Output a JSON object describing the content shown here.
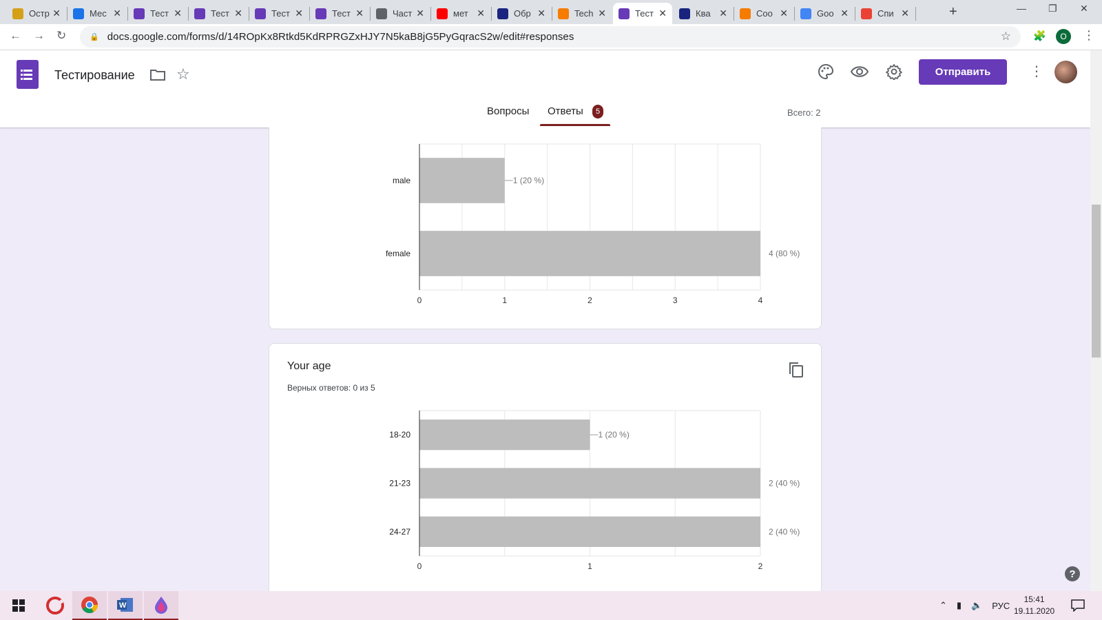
{
  "browser": {
    "tabs": [
      {
        "title": "Остр",
        "favicon_color": "#d4a017",
        "active": false
      },
      {
        "title": "Мес",
        "favicon_color": "#1a73e8",
        "active": false
      },
      {
        "title": "Тест",
        "favicon_color": "#673ab7",
        "active": false
      },
      {
        "title": "Тест",
        "favicon_color": "#673ab7",
        "active": false
      },
      {
        "title": "Тест",
        "favicon_color": "#673ab7",
        "active": false
      },
      {
        "title": "Тест",
        "favicon_color": "#673ab7",
        "active": false
      },
      {
        "title": "Част",
        "favicon_color": "#5f6368",
        "active": false
      },
      {
        "title": "мет",
        "favicon_color": "#ff0000",
        "active": false
      },
      {
        "title": "Обр",
        "favicon_color": "#1a237e",
        "active": false
      },
      {
        "title": "Tech",
        "favicon_color": "#f57c00",
        "active": false
      },
      {
        "title": "Тест",
        "favicon_color": "#673ab7",
        "active": true
      },
      {
        "title": "Ква",
        "favicon_color": "#1a237e",
        "active": false
      },
      {
        "title": "Coo",
        "favicon_color": "#f57c00",
        "active": false
      },
      {
        "title": "Goo",
        "favicon_color": "#4285f4",
        "active": false
      },
      {
        "title": "Спи",
        "favicon_color": "#ea4335",
        "active": false
      }
    ],
    "url": "docs.google.com/forms/d/14ROpKx8Rtkd5KdRPRGZxHJY7N5kaB8jG5PyGqracS2w/edit#responses",
    "profile_initial": "O"
  },
  "form": {
    "title": "Тестирование",
    "send_label": "Отправить",
    "tabs": {
      "questions": "Вопросы",
      "responses": "Ответы",
      "responses_badge": "5"
    },
    "total": "Всего: 2",
    "accent_color": "#673ab7"
  },
  "age_card": {
    "title": "Your age",
    "correct": "Верных ответов: 0 из 5"
  },
  "chart_data": [
    {
      "type": "bar",
      "orientation": "horizontal",
      "categories": [
        "male",
        "female"
      ],
      "values": [
        1,
        4
      ],
      "value_labels": [
        "1 (20 %)",
        "4 (80 %)"
      ],
      "xlim": [
        0,
        4
      ],
      "xticks": [
        "0",
        "1",
        "2",
        "3",
        "4"
      ],
      "bar_color": "#bdbdbd",
      "grid": true
    },
    {
      "type": "bar",
      "orientation": "horizontal",
      "categories": [
        "18-20",
        "21-23",
        "24-27"
      ],
      "values": [
        1,
        2,
        2
      ],
      "value_labels": [
        "1 (20 %)",
        "2 (40 %)",
        "2 (40 %)"
      ],
      "xlim": [
        0,
        2
      ],
      "xticks": [
        "0",
        "1",
        "2"
      ],
      "bar_color": "#bdbdbd",
      "grid": true
    }
  ],
  "taskbar": {
    "language": "РУС",
    "time": "15:41",
    "date": "19.11.2020"
  }
}
